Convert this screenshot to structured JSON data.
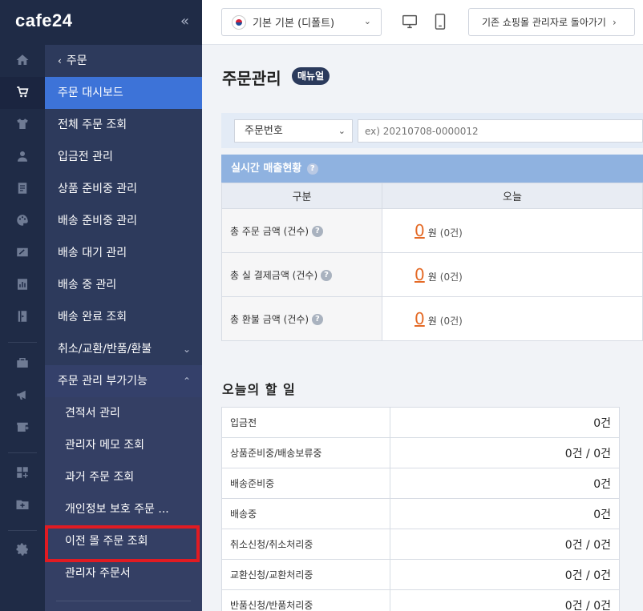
{
  "logo": "cafe24",
  "sidebar": {
    "collapse_icon": "double-chevron-left-icon",
    "back_label": "주문",
    "items": [
      {
        "label": "주문 대시보드",
        "active": true
      },
      {
        "label": "전체 주문 조회"
      },
      {
        "label": "입금전 관리"
      },
      {
        "label": "상품 준비중 관리"
      },
      {
        "label": "배송 준비중 관리"
      },
      {
        "label": "배송 대기 관리"
      },
      {
        "label": "배송 중 관리"
      },
      {
        "label": "배송 완료 조회"
      },
      {
        "label": "취소/교환/반품/환불",
        "expand": "chevron-down-icon"
      },
      {
        "label": "주문 관리 부가기능",
        "expand": "chevron-up-icon"
      }
    ],
    "sub_items": [
      {
        "label": "견적서 관리"
      },
      {
        "label": "관리자 메모 조회"
      },
      {
        "label": "과거 주문 조회"
      },
      {
        "label": "개인정보 보호 주문 ..."
      },
      {
        "label": "이전 몰 주문 조회",
        "highlighted": true
      },
      {
        "label": "관리자 주문서"
      }
    ],
    "highlight_color": "#e11b22",
    "active_color": "#3d73d8"
  },
  "rail_icons": [
    "home-icon",
    "cart-icon",
    "shirt-icon",
    "user-icon",
    "board-icon",
    "palette-icon",
    "promotion-icon",
    "chart-icon",
    "book-icon",
    "store-icon",
    "megaphone-icon",
    "shop-add-icon",
    "apps-add-icon",
    "folder-add-icon",
    "gear-icon"
  ],
  "header": {
    "shop_select": "기본 기본 (디폴트)",
    "pc_icon": "monitor-icon",
    "mobile_icon": "mobile-icon",
    "back_button": "기존 쇼핑몰 관리자로 돌아가기"
  },
  "main": {
    "title": "주문관리",
    "manual_badge": "매뉴얼",
    "search": {
      "field_select": "주문번호",
      "placeholder": "ex) 20210708-0000012"
    },
    "sales": {
      "heading": "실시간 매출현황",
      "col_category": "구분",
      "col_today": "오늘",
      "rows": [
        {
          "label": "총 주문 금액 (건수)",
          "value": "0",
          "unit": "원",
          "count": "(0건)"
        },
        {
          "label": "총 실 결제금액 (건수)",
          "value": "0",
          "unit": "원",
          "count": "(0건)"
        },
        {
          "label": "총 환불 금액 (건수)",
          "value": "0",
          "unit": "원",
          "count": "(0건)"
        }
      ]
    },
    "todo": {
      "title": "오늘의 할 일",
      "rows": [
        {
          "label": "입금전",
          "value": "0건"
        },
        {
          "label": "상품준비중/배송보류중",
          "value": "0건 / 0건"
        },
        {
          "label": "배송준비중",
          "value": "0건"
        },
        {
          "label": "배송중",
          "value": "0건"
        },
        {
          "label": "취소신청/취소처리중",
          "value": "0건 / 0건"
        },
        {
          "label": "교환신청/교환처리중",
          "value": "0건 / 0건"
        },
        {
          "label": "반품신청/반품처리중",
          "value": "0건 / 0건"
        }
      ]
    }
  }
}
